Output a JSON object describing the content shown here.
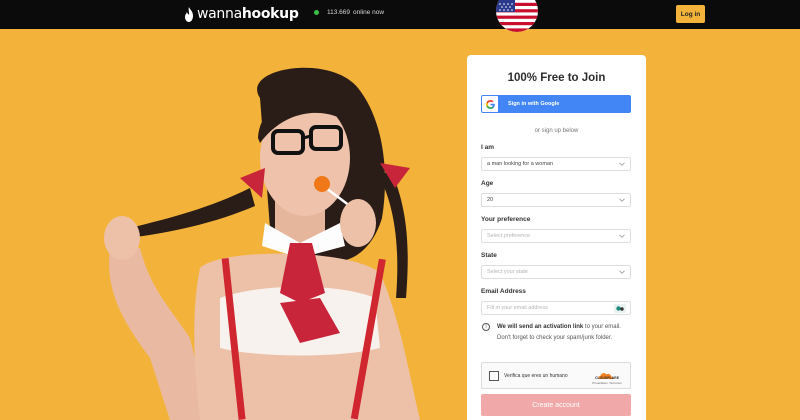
{
  "header": {
    "logo_text_light": "wanna",
    "logo_text_bold": "hookup",
    "online_count": "113.669",
    "online_label": "online now",
    "login_label": "Log in"
  },
  "colors": {
    "accent": "#f3b33a",
    "topbar": "#0b0b0b",
    "google_blue": "#4285f4",
    "create_button": "#f0a8a8",
    "online_dot": "#38c24a"
  },
  "icons": [
    "flame-icon",
    "online-status-dot",
    "us-flag-icon",
    "google-icon",
    "chevron-down-icon",
    "email-helper-icon",
    "info-icon",
    "cloudflare-logo"
  ],
  "signup": {
    "title": "100% Free to Join",
    "google_label": "Sign in with Google",
    "or_text": "or sign up below",
    "iam": {
      "label": "I am",
      "value": "a man looking for a woman"
    },
    "age": {
      "label": "Age",
      "value": "20"
    },
    "preference": {
      "label": "Your preference",
      "placeholder": "Select preference"
    },
    "state": {
      "label": "State",
      "placeholder": "Select your state"
    },
    "email": {
      "label": "Email Address",
      "placeholder": "Fill in your email address"
    },
    "notice_bold": "We will send an activation link",
    "notice_rest": "to your email. Don't forget to check your spam/junk folder.",
    "captcha_label": "Verifica que eres un humano",
    "captcha_brand": "CLOUDFLARE",
    "captcha_links": "Privacidad • Términos",
    "create_label": "Create account"
  }
}
